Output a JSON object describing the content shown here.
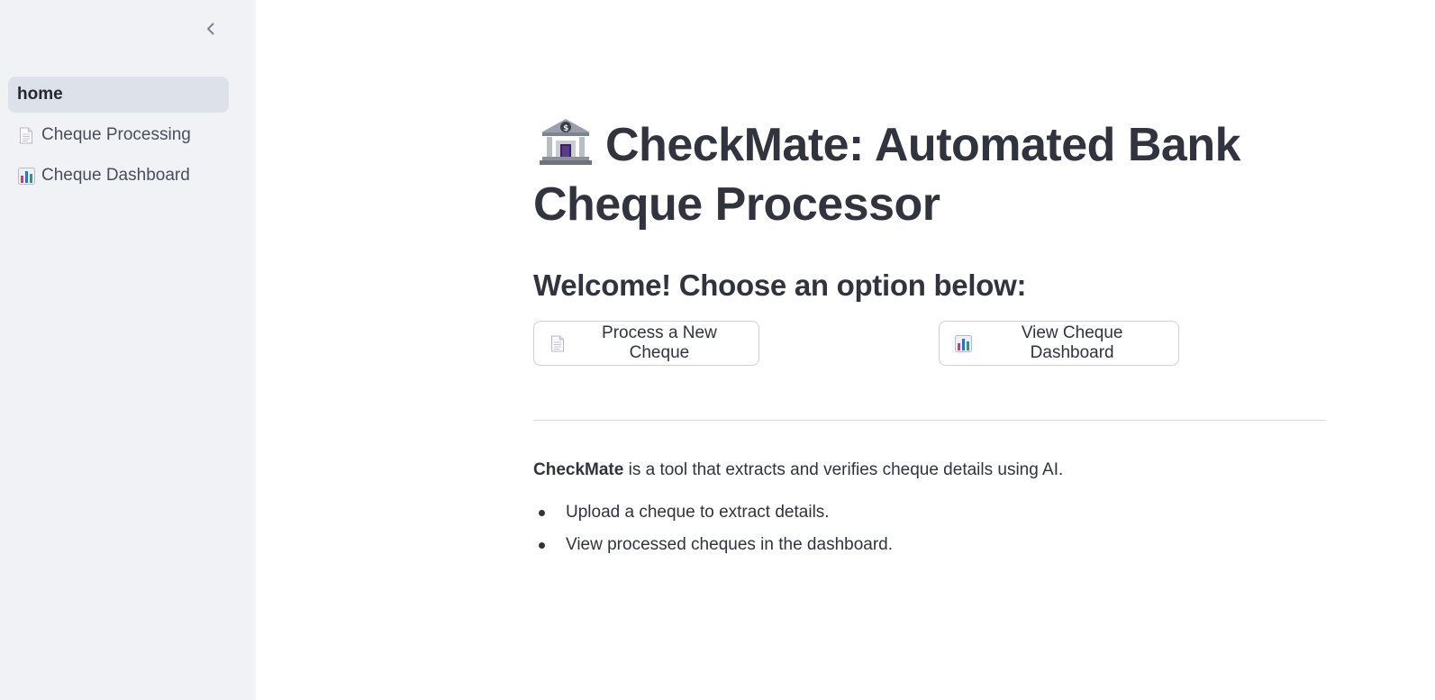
{
  "sidebar": {
    "collapse_icon": "chevron-left-icon",
    "items": [
      {
        "label": "home",
        "icon": "",
        "active": true
      },
      {
        "label": "Cheque Processing",
        "icon": "page-icon",
        "active": false
      },
      {
        "label": "Cheque Dashboard",
        "icon": "bar-chart-icon",
        "active": false
      }
    ]
  },
  "main": {
    "title_icon": "bank-icon",
    "title": "CheckMate: Automated Bank Cheque Processor",
    "subtitle": "Welcome! Choose an option below:",
    "buttons": {
      "process": {
        "label": "Process a New Cheque",
        "icon": "page-icon"
      },
      "dashboard": {
        "label": "View Cheque Dashboard",
        "icon": "bar-chart-icon"
      }
    },
    "description": {
      "bold": "CheckMate",
      "rest": " is a tool that extracts and verifies cheque details using AI."
    },
    "bullets": [
      "Upload a cheque to extract details.",
      "View processed cheques in the dashboard."
    ]
  },
  "colors": {
    "sidebar_bg": "#f0f2f6",
    "active_item_bg": "#dde1e9",
    "text": "#31333f"
  }
}
